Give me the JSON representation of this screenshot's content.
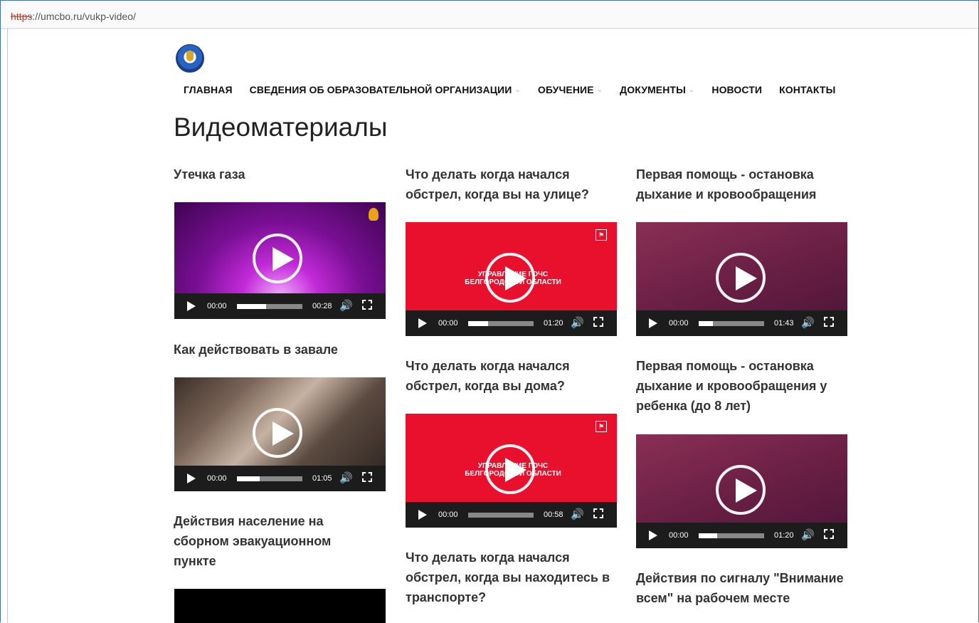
{
  "browser": {
    "url_scheme": "https",
    "url_rest": "://umcbo.ru/vukp-video/"
  },
  "header": {
    "logo_icon": "mchs-emblem-icon",
    "nav": [
      {
        "label": "ГЛАВНАЯ",
        "has_dropdown": false
      },
      {
        "label": "СВЕДЕНИЯ ОБ ОБРАЗОВАТЕЛЬНОЙ ОРГАНИЗАЦИИ",
        "has_dropdown": true
      },
      {
        "label": "ОБУЧЕНИЕ",
        "has_dropdown": true
      },
      {
        "label": "ДОКУМЕНТЫ",
        "has_dropdown": true
      },
      {
        "label": "НОВОСТИ",
        "has_dropdown": false
      },
      {
        "label": "КОНТАКТЫ",
        "has_dropdown": false
      }
    ]
  },
  "page_title": "Видеоматериалы",
  "videos": [
    {
      "title": "Утечка газа",
      "time": "00:00",
      "duration": "00:28",
      "progress": 0.45,
      "style": "purple"
    },
    {
      "title": "Как действовать в завале",
      "time": "00:00",
      "duration": "01:05",
      "progress": 0.35,
      "style": "rubble"
    },
    {
      "title": "Действия население на сборном эвакуационном пункте",
      "style": "black"
    },
    {
      "title": "Что делать когда начался обстрел, когда вы на улице?",
      "time": "00:00",
      "duration": "01:20",
      "progress": 0.3,
      "style": "red",
      "overlay": "УПРАВЛЕНИЕ ГОЧС БЕЛГОРОДСКОЙ ОБЛАСТИ"
    },
    {
      "title": "Что делать когда начался обстрел, когда вы дома?",
      "time": "00:00",
      "duration": "00:58",
      "progress": 0.0,
      "style": "red",
      "overlay": "УПРАВЛЕНИЕ ГОЧС БЕЛГОРОДСКОЙ ОБЛАСТИ"
    },
    {
      "title": "Что делать когда начался обстрел, когда вы находитесь в транспорте?"
    },
    {
      "title": "Первая помощь - остановка дыхание и кровообращения",
      "time": "00:00",
      "duration": "01:43",
      "progress": 0.22,
      "style": "plum"
    },
    {
      "title": "Первая помощь - остановка дыхание и кровообращения у ребенка (до 8 лет)",
      "time": "00:00",
      "duration": "01:20",
      "progress": 0.28,
      "style": "plum"
    },
    {
      "title": "Действия по сигналу \"Внимание всем\" на рабочем месте"
    }
  ],
  "colors": {
    "red_card": "#e8102c",
    "controls_bg": "#1c1c1c",
    "frame_border": "#3d6fc4"
  }
}
